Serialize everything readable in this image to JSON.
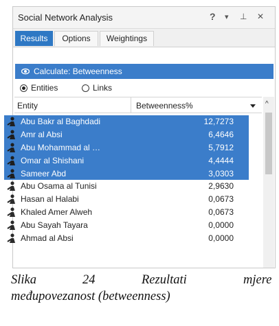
{
  "window": {
    "title": "Social Network Analysis",
    "help_glyph": "?",
    "menu_glyph": "▾",
    "pin_glyph": "⊥",
    "close_glyph": "✕"
  },
  "tabs": [
    "Results",
    "Options",
    "Weightings"
  ],
  "active_tab": "Results",
  "calculate": {
    "label": "Calculate: Betweenness",
    "icon": "eye-icon"
  },
  "view_mode": {
    "options": [
      "Entities",
      "Links"
    ],
    "selected": "Entities"
  },
  "table": {
    "columns": [
      "Entity",
      "Betweenness%"
    ],
    "sort_column": "Betweenness%",
    "rows": [
      {
        "name": "Abu Bakr al Baghdadi",
        "value": "12,7273",
        "selected": true
      },
      {
        "name": "Amr al Absi",
        "value": "6,4646",
        "selected": true
      },
      {
        "name": "Abu Mohammad al …",
        "value": "5,7912",
        "selected": true
      },
      {
        "name": "Omar al Shishani",
        "value": "4,4444",
        "selected": true
      },
      {
        "name": "Sameer Abd",
        "value": "3,0303",
        "selected": true
      },
      {
        "name": "Abu Osama al Tunisi",
        "value": "2,9630",
        "selected": false
      },
      {
        "name": "Hasan al Halabi",
        "value": "0,0673",
        "selected": false
      },
      {
        "name": "Khaled Amer Alweh",
        "value": "0,0673",
        "selected": false
      },
      {
        "name": "Abu Sayah Tayara",
        "value": "0,0000",
        "selected": false
      },
      {
        "name": "Ahmad al Absi",
        "value": "0,0000",
        "selected": false
      }
    ]
  },
  "caption": {
    "word1": "Slika",
    "word2": "24",
    "word3": "Rezultati",
    "word4": "mjere",
    "line2": "međupovezanost (betweenness)"
  },
  "colors": {
    "accent": "#3b7dca",
    "selected_text": "#ffffff",
    "panel_border": "#c9c9c9"
  }
}
